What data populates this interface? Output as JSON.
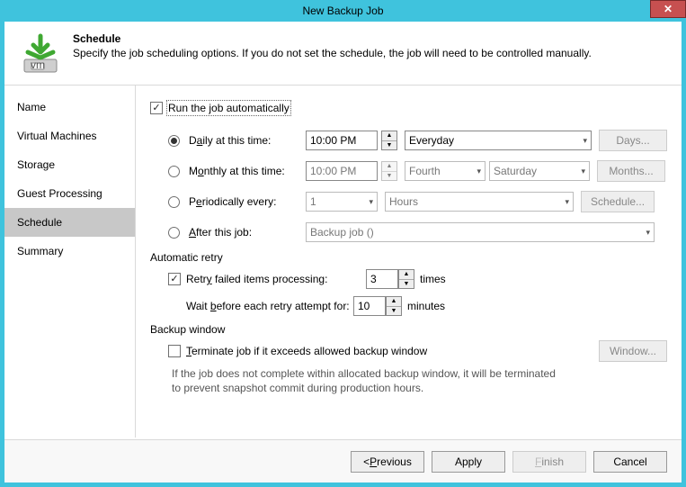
{
  "titlebar": {
    "title": "New Backup Job"
  },
  "header": {
    "title": "Schedule",
    "subtitle": "Specify the job scheduling options. If you do not set the schedule, the job will need to be controlled manually."
  },
  "sidebar": {
    "items": [
      {
        "label": "Name"
      },
      {
        "label": "Virtual Machines"
      },
      {
        "label": "Storage"
      },
      {
        "label": "Guest Processing"
      },
      {
        "label": "Schedule"
      },
      {
        "label": "Summary"
      }
    ],
    "selected_index": 4
  },
  "schedule": {
    "run_auto_label": "Run the job automatically",
    "run_auto_checked": true,
    "daily": {
      "label_before": "D",
      "label_u": "a",
      "label_after": "ily at this time:",
      "time": "10:00 PM",
      "recurrence": "Everyday",
      "days_btn": "Days..."
    },
    "monthly": {
      "label_before": "M",
      "label_u": "o",
      "label_after": "nthly at this time:",
      "time": "10:00 PM",
      "week": "Fourth",
      "day": "Saturday",
      "months_btn": "Months..."
    },
    "periodic": {
      "label_before": "P",
      "label_u": "e",
      "label_after": "riodically every:",
      "value": "1",
      "unit": "Hours",
      "sched_btn": "Schedule..."
    },
    "after": {
      "label_before": "",
      "label_u": "A",
      "label_after": "fter this job:",
      "job": "Backup job ()"
    }
  },
  "retry": {
    "section": "Automatic retry",
    "retry_label_before": "Retr",
    "retry_label_u": "y",
    "retry_label_after": " failed items processing:",
    "retry_checked": true,
    "retry_count": "3",
    "retry_times": "times",
    "wait_label_before": "Wait ",
    "wait_label_u": "b",
    "wait_label_after": "efore each retry attempt for:",
    "wait_value": "10",
    "wait_unit": "minutes"
  },
  "window_sec": {
    "section": "Backup window",
    "terminate_label_before": "",
    "terminate_label_u": "T",
    "terminate_label_after": "erminate job if it exceeds allowed backup window",
    "terminate_checked": false,
    "window_btn": "Window...",
    "note": "If the job does not complete within allocated backup window, it will be terminated to prevent snapshot commit during production hours."
  },
  "footer": {
    "previous": "< Previous",
    "previous_u": "P",
    "apply": "Apply",
    "finish": "Finish",
    "finish_u": "F",
    "cancel": "Cancel"
  }
}
